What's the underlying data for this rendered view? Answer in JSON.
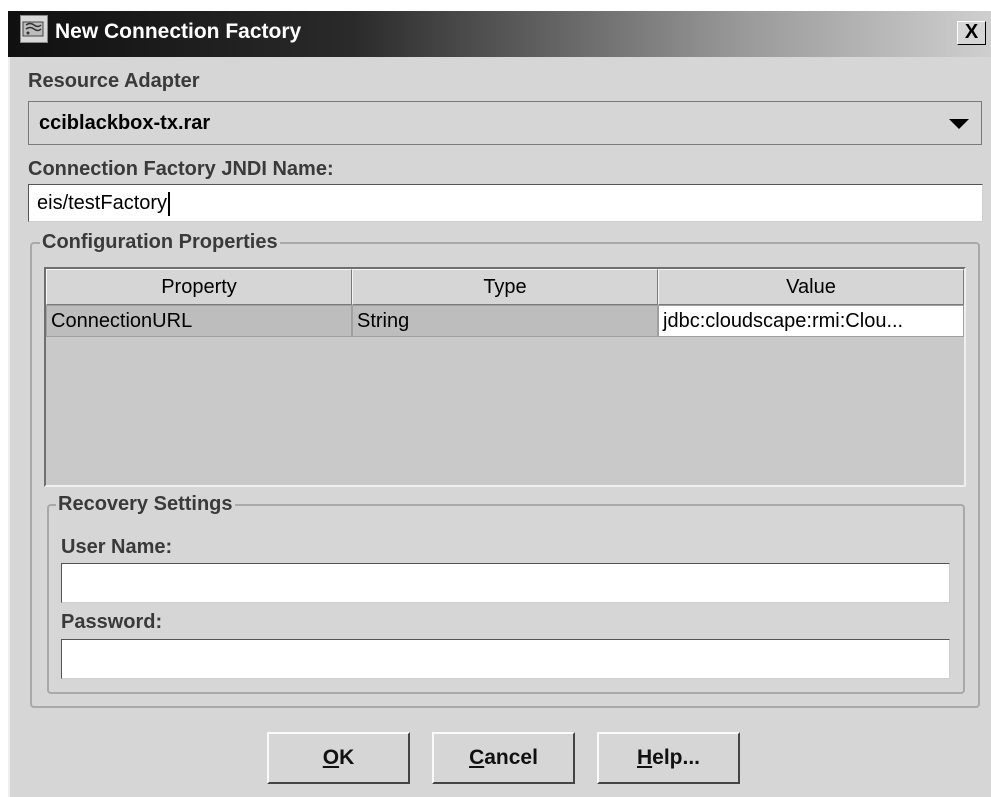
{
  "window": {
    "title": "New Connection Factory",
    "close_label": "X"
  },
  "resource_adapter": {
    "label": "Resource Adapter",
    "selected": "cciblackbox-tx.rar"
  },
  "jndi": {
    "label": "Connection Factory JNDI Name:",
    "value": "eis/testFactory"
  },
  "config": {
    "legend": "Configuration Properties",
    "columns": [
      "Property",
      "Type",
      "Value"
    ],
    "rows": [
      {
        "property": "ConnectionURL",
        "type": "String",
        "value": "jdbc:cloudscape:rmi:Clou..."
      }
    ]
  },
  "recovery": {
    "legend": "Recovery Settings",
    "username_label": "User Name:",
    "username_value": "",
    "password_label": "Password:",
    "password_value": ""
  },
  "buttons": {
    "ok": {
      "mnemonic": "O",
      "rest": "K"
    },
    "cancel": {
      "mnemonic": "C",
      "rest": "ancel"
    },
    "help": {
      "mnemonic": "H",
      "rest": "elp..."
    }
  }
}
